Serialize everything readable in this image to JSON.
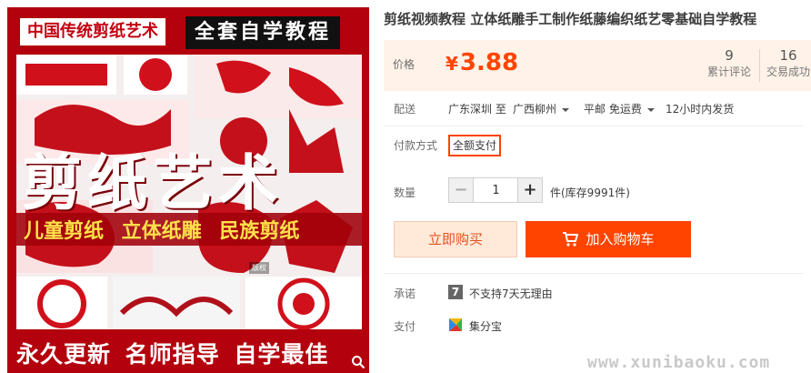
{
  "product_image": {
    "banner_left": "中国传统剪纸艺术",
    "banner_right": "全套自学教程",
    "big_title": "剪纸艺术",
    "subtitle": "儿童剪纸  立体纸雕  民族剪纸",
    "footer": "永久更新 名师指导 自学最佳",
    "tag": "版权",
    "zoom_icon": "magnifier-icon"
  },
  "title": "剪纸视频教程 立体纸雕手工制作纸藤编织纸艺零基础自学教程",
  "price": {
    "label": "价格",
    "currency": "¥",
    "value": "3.88",
    "reviews_count": "9",
    "reviews_label": "累计评论",
    "sales_count": "16",
    "sales_label": "交易成功"
  },
  "shipping": {
    "label": "配送",
    "from_to": "广东深圳 至",
    "destination": "广西柳州",
    "method": "平邮 免运费",
    "dispatch": "12小时内发货"
  },
  "payment_method": {
    "label": "付款方式",
    "option": "全额支付"
  },
  "quantity": {
    "label": "数量",
    "minus": "−",
    "value": "1",
    "plus": "+",
    "stock": "件(库存9991件)"
  },
  "actions": {
    "buy_now": "立即购买",
    "add_to_cart": "加入购物车"
  },
  "promise": {
    "label": "承诺",
    "icon_text": "7",
    "text": "不支持7天无理由"
  },
  "pay": {
    "label": "支付",
    "method": "集分宝"
  },
  "watermark": "www.xunibaoku.com",
  "colors": {
    "accent": "#ff4400",
    "image_red": "#b3020d",
    "price_bg": "#fff2e8",
    "subtitle_yellow": "#ffe14a"
  }
}
